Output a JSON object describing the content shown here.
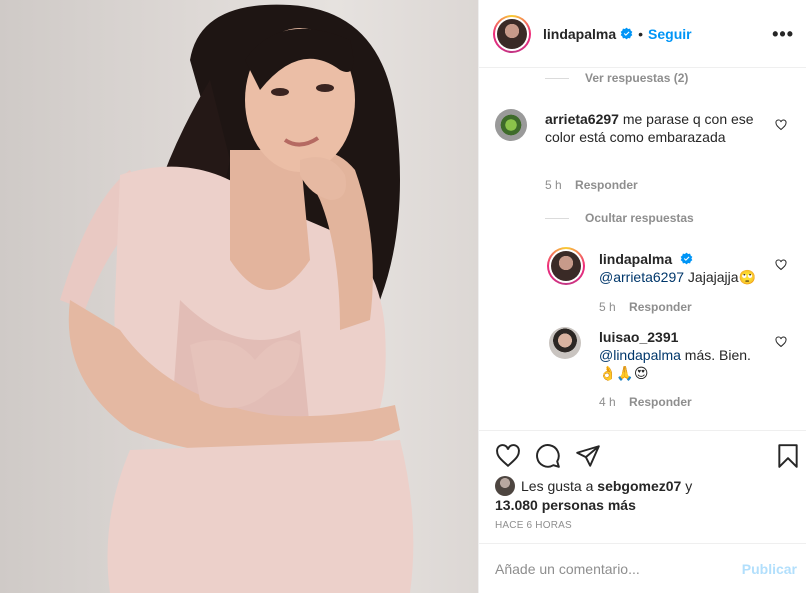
{
  "header": {
    "username": "lindapalma",
    "separator": "•",
    "follow_label": "Seguir",
    "more_label": "•••"
  },
  "comments": {
    "view_replies": "Ver respuestas (2)",
    "items": [
      {
        "username": "arrieta6297",
        "text": "me parase q con ese color está como embarazada",
        "time": "5 h",
        "reply_label": "Responder"
      }
    ],
    "hide_replies": "Ocultar respuestas",
    "replies": [
      {
        "username": "lindapalma",
        "mention": "@arrieta6297",
        "text": " Jajajajja🙄",
        "time": "5 h",
        "reply_label": "Responder"
      },
      {
        "username": "luisao_2391",
        "mention": "@lindapalma",
        "text": " más. Bien.",
        "emojis": "👌🙏😍",
        "time": "4 h",
        "reply_label": "Responder"
      }
    ]
  },
  "likes": {
    "prefix": "Les gusta a ",
    "user": "sebgomez07",
    "connector": " y",
    "count": "13.080 personas más"
  },
  "timestamp": "HACE 6 HORAS",
  "add_comment": {
    "placeholder": "Añade un comentario...",
    "publish_label": "Publicar"
  },
  "colors": {
    "accent": "#0095f6",
    "publish_disabled": "#b2dffc",
    "muted": "#8e8e8e",
    "outfit": "#e9c9c3"
  },
  "icons": [
    "heart-icon",
    "comment-icon",
    "share-icon",
    "bookmark-icon",
    "verified-badge-icon",
    "more-options-icon"
  ]
}
